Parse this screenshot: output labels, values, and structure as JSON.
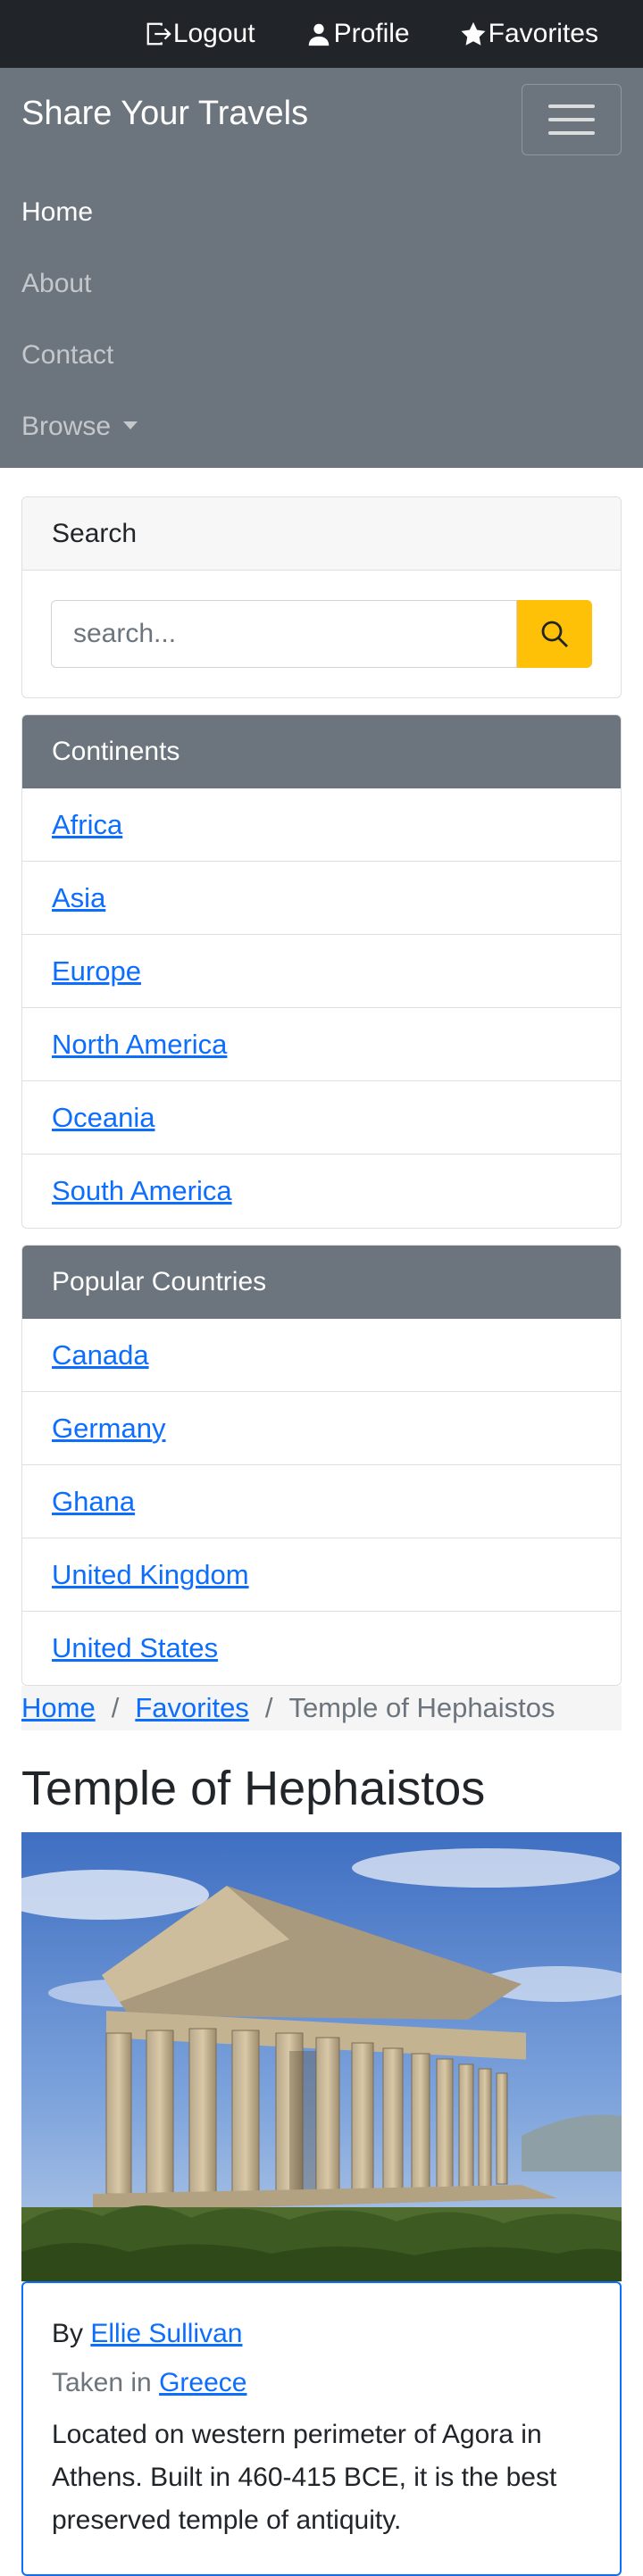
{
  "topbar": {
    "logout": "Logout",
    "profile": "Profile",
    "favorites": "Favorites"
  },
  "navbar": {
    "brand": "Share Your Travels",
    "items": [
      {
        "label": "Home"
      },
      {
        "label": "About"
      },
      {
        "label": "Contact"
      },
      {
        "label": "Browse"
      }
    ]
  },
  "search": {
    "header": "Search",
    "placeholder": "search..."
  },
  "continents": {
    "header": "Continents",
    "items": [
      "Africa",
      "Asia",
      "Europe",
      "North America",
      "Oceania",
      "South America"
    ]
  },
  "countries": {
    "header": "Popular Countries",
    "items": [
      "Canada",
      "Germany",
      "Ghana",
      "United Kingdom",
      "United States"
    ]
  },
  "breadcrumb": {
    "home": "Home",
    "favorites": "Favorites",
    "current": "Temple of Hephaistos",
    "separator": "/"
  },
  "photo": {
    "title": "Temple of Hephaistos",
    "by_prefix": "By",
    "author": "Ellie Sullivan",
    "taken_prefix": "Taken in",
    "country": "Greece",
    "description": "Located on western perimeter of Agora in Athens. Built in 460-415 BCE, it is the best preserved temple of antiquity."
  },
  "colors": {
    "topbar": "#212529",
    "navbar": "#6c757d",
    "link": "#0d6efd",
    "search_button": "#ffc107"
  }
}
